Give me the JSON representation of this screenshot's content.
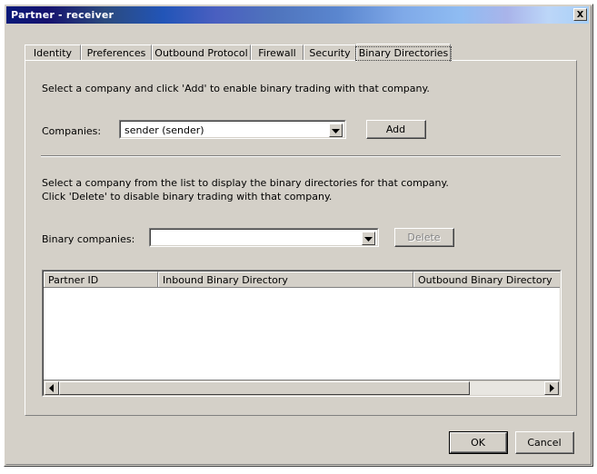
{
  "window": {
    "title": "Partner - receiver",
    "close_icon": "close-x-icon"
  },
  "tabs": [
    {
      "label": "Identity",
      "selected": false
    },
    {
      "label": "Preferences",
      "selected": false
    },
    {
      "label": "Outbound Protocol",
      "selected": false
    },
    {
      "label": "Firewall",
      "selected": false
    },
    {
      "label": "Security",
      "selected": false
    },
    {
      "label": "Binary Directories",
      "selected": true
    }
  ],
  "panel": {
    "add_section": {
      "hint": "Select a company and click 'Add' to enable binary trading with that company.",
      "companies_label": "Companies:",
      "companies_value": "sender (sender)",
      "companies_placeholder": "",
      "companies_options": [
        "sender (sender)"
      ],
      "add_button": "Add"
    },
    "delete_section": {
      "hint_line1": "Select a company from the list to display the binary directories for that company.",
      "hint_line2": "Click 'Delete' to disable binary trading with that company.",
      "binary_companies_label": "Binary companies:",
      "binary_companies_value": "",
      "binary_companies_placeholder": "",
      "binary_companies_options": [],
      "delete_button": "Delete",
      "delete_button_enabled": false
    },
    "table": {
      "columns": [
        {
          "label": "Partner ID"
        },
        {
          "label": "Inbound Binary Directory"
        },
        {
          "label": "Outbound Binary Directory"
        }
      ],
      "rows": []
    },
    "scrollbar": {
      "left_arrow_icon": "triangle-left-icon",
      "right_arrow_icon": "triangle-right-icon"
    }
  },
  "footer": {
    "ok_button": "OK",
    "cancel_button": "Cancel"
  },
  "colors": {
    "face": "#d4d0c8",
    "title_start": "#0a1a7a",
    "title_end": "#a8d0f7",
    "field_bg": "#ffffff",
    "disabled_text": "#808080"
  }
}
